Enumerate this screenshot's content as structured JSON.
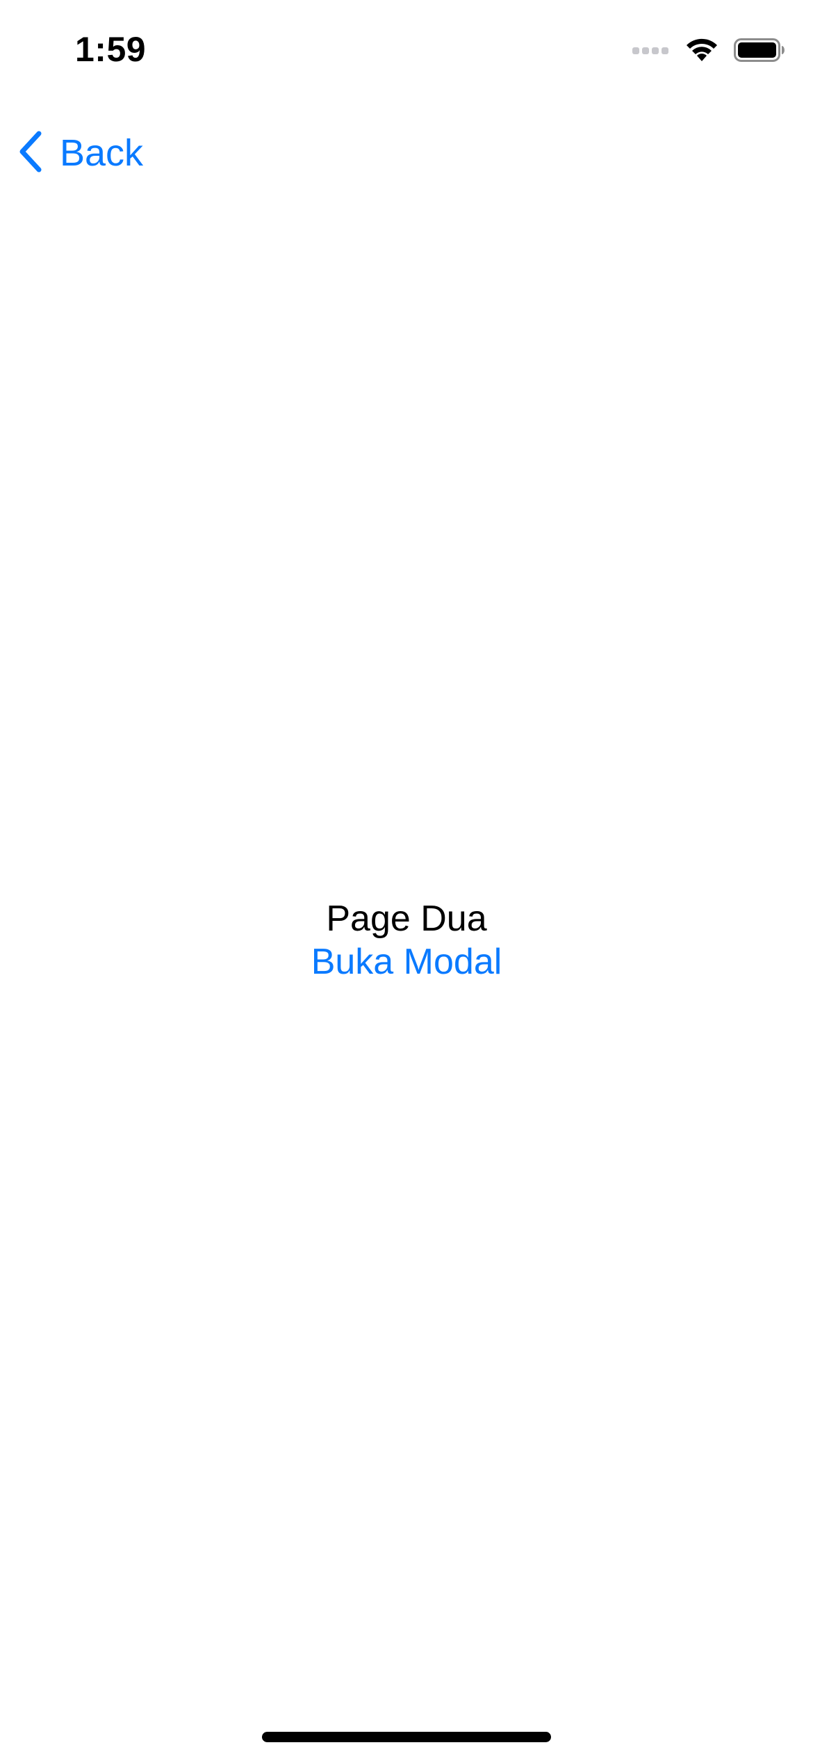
{
  "status_bar": {
    "time": "1:59",
    "icons": [
      "cellular-signal-icon",
      "wifi-icon",
      "battery-icon"
    ]
  },
  "nav": {
    "back_label": "Back",
    "back_icon": "chevron-left-icon"
  },
  "main": {
    "title": "Page Dua",
    "button_label": "Buka Modal"
  },
  "colors": {
    "accent": "#0a7aff",
    "text": "#000000",
    "background": "#ffffff"
  }
}
